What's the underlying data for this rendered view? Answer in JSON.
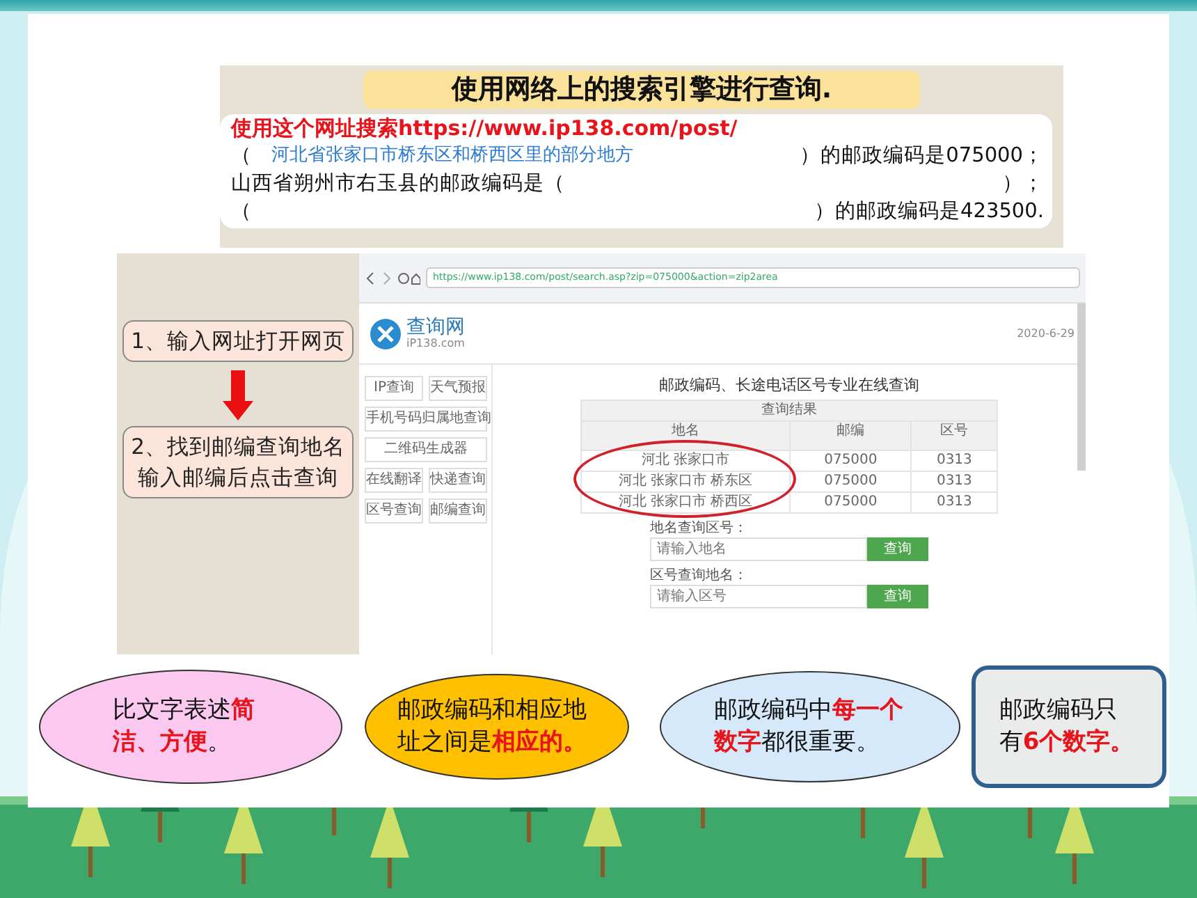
{
  "search_card": {
    "title": "使用网络上的搜索引擎进行查询.",
    "lines": [
      {
        "kind": "instruction",
        "segments": [
          {
            "kind": "plain",
            "text": "使用这个网址搜索https://www.ip138.com/post/"
          }
        ]
      },
      {
        "kind": "question",
        "segments": [
          {
            "kind": "plain",
            "text": "（"
          },
          {
            "kind": "hint",
            "text": "河北省张家口市桥东区和桥西区里的部分地方"
          },
          {
            "kind": "blank"
          },
          {
            "kind": "plain",
            "text": "）的邮政编码是075000；"
          }
        ]
      },
      {
        "kind": "question",
        "segments": [
          {
            "kind": "plain",
            "text": "山西省朔州市右玉县的邮政编码是（"
          },
          {
            "kind": "blank"
          },
          {
            "kind": "plain",
            "text": "）；"
          }
        ]
      },
      {
        "kind": "question",
        "segments": [
          {
            "kind": "plain",
            "text": "（"
          },
          {
            "kind": "blank"
          },
          {
            "kind": "plain",
            "text": "）的邮政编码是423500."
          }
        ]
      }
    ]
  },
  "steps": [
    {
      "lines": [
        "1、输入网址打开网页"
      ]
    },
    {
      "lines": [
        "2、找到邮编查询地名",
        "输入邮编后点击查询"
      ]
    }
  ],
  "browser": {
    "url": "https://www.ip138.com/post/search.asp?zip=075000&action=zip2area",
    "site_name": "查询网",
    "site_domain": "iP138.com",
    "date": "2020-6-29",
    "sidebar": [
      {
        "kind": "half",
        "text": "IP查询"
      },
      {
        "kind": "half",
        "text": "天气预报"
      },
      {
        "kind": "wide",
        "text": "手机号码归属地查询"
      },
      {
        "kind": "wide",
        "text": "二维码生成器"
      },
      {
        "kind": "half",
        "text": "在线翻译"
      },
      {
        "kind": "half",
        "text": "快递查询"
      },
      {
        "kind": "half",
        "text": "区号查询"
      },
      {
        "kind": "half",
        "text": "邮编查询"
      }
    ],
    "title": "邮政编码、长途电话区号专业在线查询",
    "table": {
      "caption": "查询结果",
      "columns": [
        "地名",
        "邮编",
        "区号"
      ],
      "rows": [
        [
          "河北 张家口市",
          "075000",
          "0313"
        ],
        [
          "河北 张家口市 桥东区",
          "075000",
          "0313"
        ],
        [
          "河北 张家口市 桥西区",
          "075000",
          "0313"
        ]
      ]
    },
    "forms": [
      {
        "label": "地名查询区号：",
        "placeholder": "请输入地名",
        "button": "查询"
      },
      {
        "label": "区号查询地名：",
        "placeholder": "请输入区号",
        "button": "查询"
      }
    ]
  },
  "bubbles": [
    {
      "kind": "ellipse",
      "color": "#fbc8f0",
      "segments": [
        {
          "text": "比文字表述",
          "emphasis": false
        },
        {
          "text": "简洁、方便",
          "emphasis": true
        },
        {
          "text": "。",
          "emphasis": false
        }
      ]
    },
    {
      "kind": "ellipse",
      "color": "#ffc000",
      "segments": [
        {
          "text": "邮政编码和相应地址之间是",
          "emphasis": false
        },
        {
          "text": "相应的。",
          "emphasis": true
        }
      ]
    },
    {
      "kind": "ellipse",
      "color": "#d6e9fb",
      "segments": [
        {
          "text": "邮政编码中",
          "emphasis": false
        },
        {
          "text": "每一个数字",
          "emphasis": true
        },
        {
          "text": "都很重要。",
          "emphasis": false
        }
      ]
    },
    {
      "kind": "rect",
      "color": "#e9ecea",
      "segments": [
        {
          "text": "邮政编码只有",
          "emphasis": false
        },
        {
          "text": "6个数字。",
          "emphasis": true
        }
      ]
    }
  ]
}
